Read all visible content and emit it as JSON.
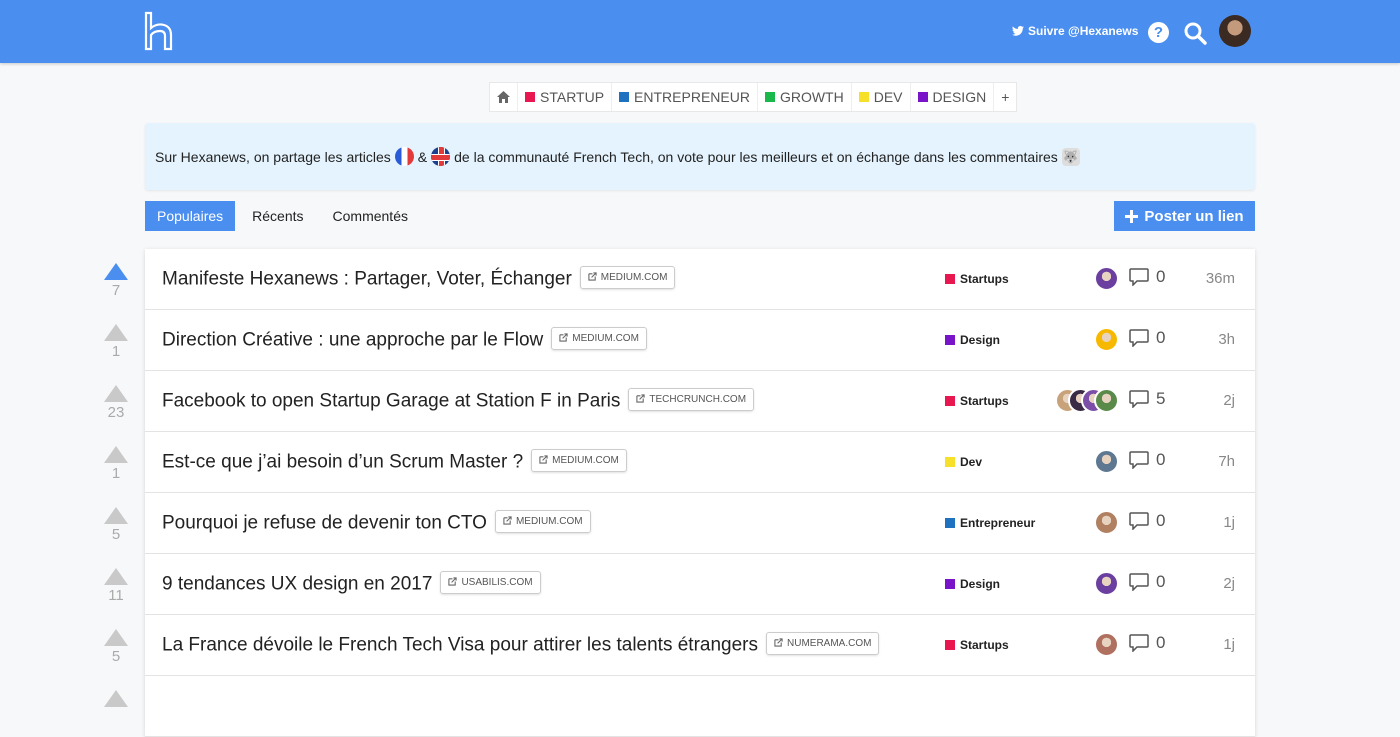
{
  "header": {
    "logo_alt": "h",
    "follow_label": "Suivre @Hexanews",
    "help_glyph": "?"
  },
  "categories": [
    {
      "label": "STARTUP",
      "color": "#e8174f"
    },
    {
      "label": "ENTREPRENEUR",
      "color": "#1e72c0"
    },
    {
      "label": "GROWTH",
      "color": "#18b84a"
    },
    {
      "label": "DEV",
      "color": "#f6e02a"
    },
    {
      "label": "DESIGN",
      "color": "#7a14c8"
    }
  ],
  "add_category_label": "+",
  "info": {
    "text_before": "Sur Hexanews, on partage les articles",
    "ampersand": "&",
    "text_after": "de la communauté French Tech, on vote pour les meilleurs et on échange dans les commentaires"
  },
  "tabs": [
    "Populaires",
    "Récents",
    "Commentés"
  ],
  "post_button_label": "Poster un lien",
  "posts": [
    {
      "votes": "7",
      "title": "Manifeste Hexanews : Partager, Voter, Échanger",
      "domain": "MEDIUM.COM",
      "category": "Startups",
      "cat_color": "#e8174f",
      "comments": "0",
      "time": "36m"
    },
    {
      "votes": "1",
      "title": "Direction Créative : une approche par le Flow",
      "domain": "MEDIUM.COM",
      "category": "Design",
      "cat_color": "#7a14c8",
      "comments": "0",
      "time": "3h"
    },
    {
      "votes": "23",
      "title": "Facebook to open Startup Garage at Station F in Paris",
      "domain": "TECHCRUNCH.COM",
      "category": "Startups",
      "cat_color": "#e8174f",
      "comments": "5",
      "time": "2j"
    },
    {
      "votes": "1",
      "title": "Est-ce que j’ai besoin d’un Scrum Master ?",
      "domain": "MEDIUM.COM",
      "category": "Dev",
      "cat_color": "#f6e02a",
      "comments": "0",
      "time": "7h"
    },
    {
      "votes": "5",
      "title": "Pourquoi je refuse de devenir ton CTO",
      "domain": "MEDIUM.COM",
      "category": "Entrepreneur",
      "cat_color": "#1e72c0",
      "comments": "0",
      "time": "1j"
    },
    {
      "votes": "11",
      "title": "9 tendances UX design en 2017",
      "domain": "USABILIS.COM",
      "category": "Design",
      "cat_color": "#7a14c8",
      "comments": "0",
      "time": "2j"
    },
    {
      "votes": "5",
      "title": "La France dévoile le French Tech Visa pour attirer les talents étrangers",
      "domain": "NUMERAMA.COM",
      "category": "Startups",
      "cat_color": "#e8174f",
      "comments": "0",
      "time": "1j"
    }
  ]
}
